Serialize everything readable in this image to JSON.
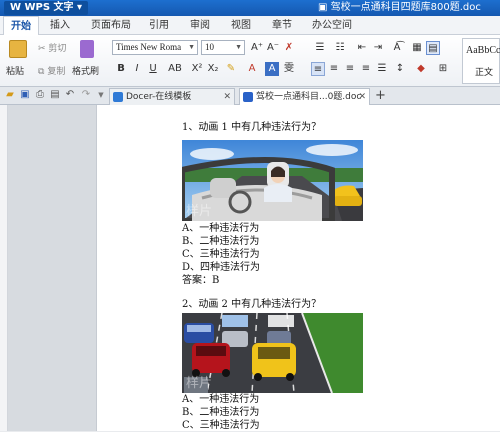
{
  "app": {
    "name": "WPS 文字",
    "document_title": "驾校一点通科目四题库800题.doc"
  },
  "ribbon_tabs": [
    "开始",
    "插入",
    "页面布局",
    "引用",
    "审阅",
    "视图",
    "章节",
    "办公空间"
  ],
  "toolbar": {
    "paste": "粘贴",
    "cut": "剪切",
    "copy": "复制",
    "format_painter": "格式刷",
    "font_name": "Times New Roma",
    "font_size": "10",
    "style_sample": "AaBbCc",
    "style_label": "正文"
  },
  "doc_tabs": [
    {
      "label": "Docer-在线模板",
      "active": false
    },
    {
      "label": "驾校一点通科目...0题.doc",
      "active": true
    }
  ],
  "questions": [
    {
      "title": "1、动画 1 中有几种违法行为？",
      "options": [
        "A、一种违法行为",
        "B、二种违法行为",
        "C、三种违法行为",
        "D、四种违法行为"
      ],
      "answer": "答案：B",
      "watermark": "样片"
    },
    {
      "title": "2、动画 2 中有几种违法行为？",
      "options": [
        "A、一种违法行为",
        "B、二种违法行为",
        "C、三种违法行为"
      ],
      "watermark": "样片"
    }
  ],
  "colors": {
    "title_bar": "#1d6fcf",
    "accent": "#1a55a8",
    "page": "#ffffff"
  }
}
